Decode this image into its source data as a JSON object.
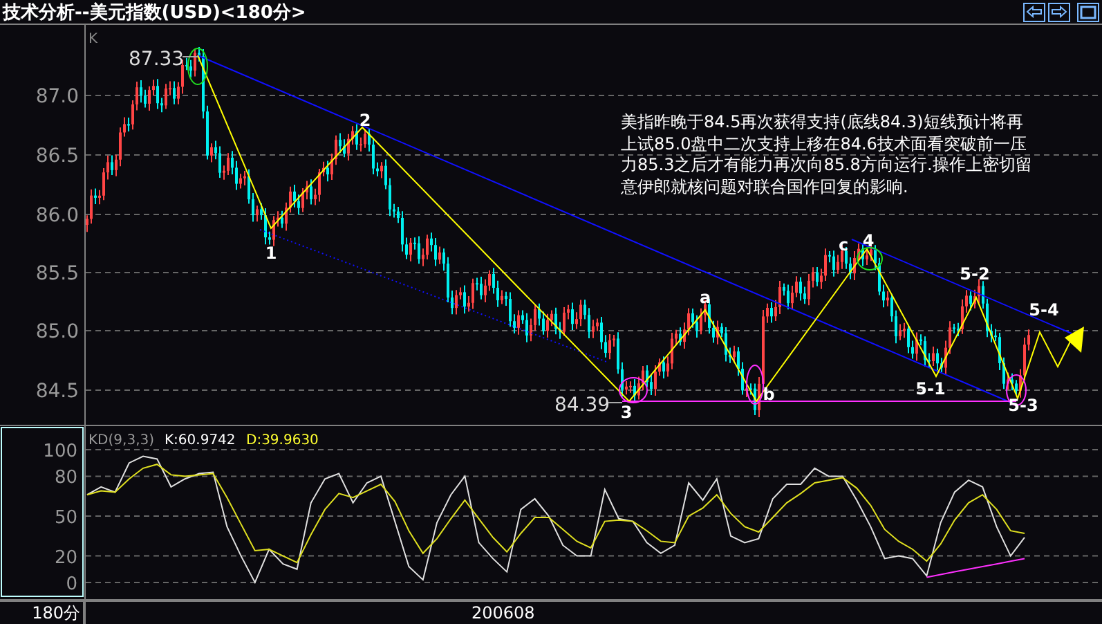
{
  "title": "技术分析--美元指数(USD)<180分>",
  "price_panel": {
    "label": "K",
    "y_ticks": [
      "87.0",
      "86.5",
      "86.0",
      "85.5",
      "85.0",
      "84.5"
    ],
    "high_label": "87.33",
    "low_label": "84.39",
    "wave_labels": [
      "1",
      "2",
      "3",
      "a",
      "b",
      "c",
      "4",
      "5-1",
      "5-2",
      "5-3",
      "5-4"
    ],
    "commentary": "美指昨晚于84.5再次获得支持(底线84.3)短线预计将再上试85.0盘中二次支持上移在84.6技术面看突破前一压力85.3之后才有能力再次向85.8方向运行.操作上密切留意伊郎就核问题对联合国作回复的影响."
  },
  "kd_panel": {
    "name": "KD(9,3,3)",
    "chart_data": {
      "type": "line",
      "ylim": [
        0,
        100
      ],
      "grid": true,
      "yticks": [
        100,
        80,
        50,
        20,
        0
      ],
      "series": [
        {
          "name": "K:60.9742",
          "color": "#e0e0e0",
          "values": [
            66,
            72,
            68,
            90,
            95,
            93,
            72,
            78,
            82,
            83,
            42,
            20,
            0,
            25,
            14,
            10,
            60,
            78,
            82,
            60,
            75,
            80,
            46,
            12,
            2,
            45,
            66,
            80,
            30,
            18,
            8,
            55,
            63,
            50,
            28,
            20,
            20,
            70,
            48,
            46,
            30,
            22,
            28,
            75,
            62,
            78,
            35,
            30,
            33,
            63,
            74,
            74,
            86,
            80,
            80,
            62,
            42,
            18,
            20,
            18,
            5,
            45,
            68,
            77,
            72,
            42,
            20,
            34
          ]
        },
        {
          "name": "D:39.9630",
          "color": "#e0e020",
          "values": [
            66,
            69,
            68,
            78,
            86,
            89,
            81,
            80,
            81,
            82,
            64,
            44,
            24,
            25,
            20,
            15,
            36,
            55,
            67,
            64,
            69,
            74,
            61,
            39,
            22,
            33,
            48,
            62,
            48,
            34,
            23,
            37,
            49,
            49,
            40,
            31,
            26,
            46,
            47,
            46,
            39,
            31,
            30,
            50,
            56,
            66,
            52,
            42,
            38,
            49,
            60,
            67,
            75,
            77,
            79,
            71,
            58,
            40,
            31,
            25,
            16,
            29,
            47,
            60,
            66,
            55,
            39,
            37
          ]
        },
        {
          "color": "#ff30ff",
          "values": [
            null,
            null,
            null,
            null,
            null,
            null,
            null,
            null,
            null,
            null,
            null,
            null,
            null,
            null,
            null,
            null,
            null,
            null,
            null,
            null,
            null,
            null,
            null,
            null,
            null,
            null,
            null,
            null,
            null,
            null,
            null,
            null,
            null,
            null,
            null,
            null,
            null,
            null,
            null,
            null,
            null,
            null,
            null,
            null,
            null,
            null,
            null,
            null,
            null,
            null,
            null,
            null,
            null,
            null,
            null,
            null,
            null,
            null,
            null,
            null,
            4,
            6,
            8,
            10,
            12,
            14,
            16,
            18
          ]
        }
      ]
    }
  },
  "bottom_bar": {
    "period": "180分",
    "date": "200608"
  }
}
